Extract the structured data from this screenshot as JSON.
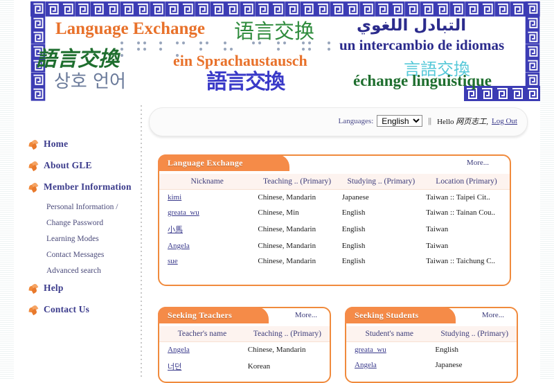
{
  "banner": {
    "phrases": [
      {
        "text": "Language Exchange",
        "lang": "en"
      },
      {
        "text": "语言交换",
        "lang": "zh-Hans"
      },
      {
        "text": "التبادل اللغوي",
        "lang": "ar"
      },
      {
        "text": "語言交換",
        "lang": "zh-Hant"
      },
      {
        "text": "un intercambio de idiomas",
        "lang": "es"
      },
      {
        "text": "ein Sprachaustausch",
        "lang": "de"
      },
      {
        "text": "상호 언어",
        "lang": "ko"
      },
      {
        "text": "語言交換",
        "lang": "zh-seal"
      },
      {
        "text": "言語交換",
        "lang": "ja"
      },
      {
        "text": "échange linguistique",
        "lang": "fr"
      }
    ],
    "colors": {
      "orange": "#E8712A",
      "green": "#2E8B3C",
      "navy": "#2B2B8C",
      "blue": "#3A3AC8",
      "grayblue": "#6A7A9A",
      "cyan": "#55C8D8",
      "darkgreen": "#1E6E2E",
      "border": "#3C3CB4"
    }
  },
  "toolbar": {
    "languages_label": "Languages:",
    "language_selected": "English",
    "language_options": [
      "English"
    ],
    "separator": "||",
    "greeting_prefix": "Hello",
    "user_name": "网页志工",
    "greeting_suffix": ",",
    "logout_label": "Log Out"
  },
  "sidebar": {
    "items": [
      {
        "label": "Home",
        "type": "main"
      },
      {
        "label": "About GLE",
        "type": "main"
      },
      {
        "label": "Member Information",
        "type": "main"
      },
      {
        "label": "Personal Information /",
        "type": "sub"
      },
      {
        "label": "Change Password",
        "type": "sub"
      },
      {
        "label": "Learning Modes",
        "type": "sub"
      },
      {
        "label": "Contact Messages",
        "type": "sub"
      },
      {
        "label": "Advanced search",
        "type": "sub"
      },
      {
        "label": "Help",
        "type": "main"
      },
      {
        "label": "Contact Us",
        "type": "main"
      }
    ]
  },
  "panels": {
    "language_exchange": {
      "title": "Language Exchange",
      "more_label": "More...",
      "columns": [
        "Nickname",
        "Teaching .. (Primary)",
        "Studying .. (Primary)",
        "Location (Primary)"
      ],
      "rows": [
        {
          "nickname": "kimi",
          "teaching": "Chinese, Mandarin",
          "studying": "Japanese",
          "location": "Taiwan :: Taipei Cit.."
        },
        {
          "nickname": "greata_wu",
          "teaching": "Chinese, Min",
          "studying": "English",
          "location": "Taiwan :: Tainan Cou.."
        },
        {
          "nickname": "小馬",
          "teaching": "Chinese, Mandarin",
          "studying": "English",
          "location": "Taiwan"
        },
        {
          "nickname": "Angela",
          "teaching": "Chinese, Mandarin",
          "studying": "English",
          "location": "Taiwan"
        },
        {
          "nickname": "sue",
          "teaching": "Chinese, Mandarin",
          "studying": "English",
          "location": "Taiwan :: Taichung C.."
        }
      ]
    },
    "seeking_teachers": {
      "title": "Seeking Teachers",
      "more_label": "More...",
      "columns": [
        "Teacher's name",
        "Teaching .. (Primary)"
      ],
      "rows": [
        {
          "name": "Angela",
          "subject": "Chinese, Mandarin"
        },
        {
          "name": "너던",
          "subject": "Korean"
        }
      ]
    },
    "seeking_students": {
      "title": "Seeking Students",
      "more_label": "More...",
      "columns": [
        "Student's name",
        "Studying .. (Primary)"
      ],
      "rows": [
        {
          "name": "greata_wu",
          "subject": "English"
        },
        {
          "name": "Angela",
          "subject": "Japanese"
        }
      ]
    }
  },
  "theme": {
    "accent_orange": "#F58B48",
    "panel_border": "#F08A3C",
    "link_navy": "#3A3A8C",
    "header_bg": "#FDF3EF"
  }
}
